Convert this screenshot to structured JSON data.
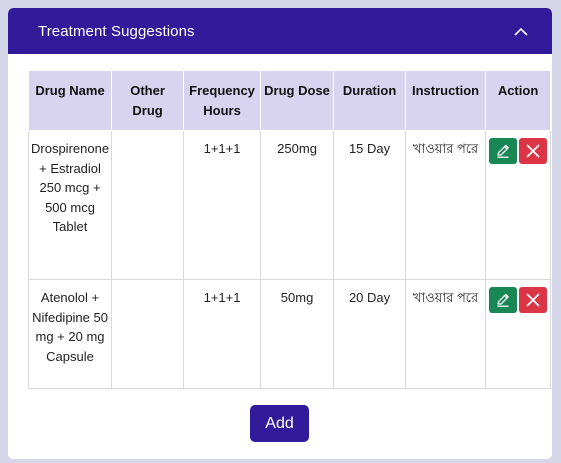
{
  "panel": {
    "title": "Treatment Suggestions",
    "collapse_icon": "chevron-up-icon"
  },
  "table": {
    "headers": [
      "Drug Name",
      "Other Drug",
      "Frequency Hours",
      "Drug Dose",
      "Duration",
      "Instruction",
      "Action"
    ],
    "rows": [
      {
        "drug_name": "Drospirenone + Estradiol 250 mcg + 500 mcg Tablet",
        "other_drug": "",
        "frequency": "1+1+1",
        "dose": "250mg",
        "duration": "15 Day",
        "instruction": "খাওয়ার পরে"
      },
      {
        "drug_name": "Atenolol + Nifedipine 50 mg + 20 mg Capsule",
        "other_drug": "",
        "frequency": "1+1+1",
        "dose": "50mg",
        "duration": "20 Day",
        "instruction": "খাওয়ার পরে"
      }
    ]
  },
  "actions": {
    "edit_icon": "edit-icon",
    "delete_icon": "close-icon",
    "edit_color": "#198754",
    "delete_color": "#dc3545"
  },
  "add_button": {
    "label": "Add"
  },
  "colors": {
    "accent": "#321b9b",
    "header_bg": "#d8d4ef",
    "page_bg": "#d6d6e9"
  }
}
